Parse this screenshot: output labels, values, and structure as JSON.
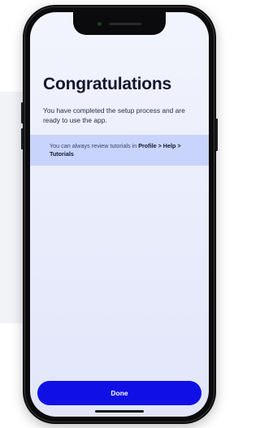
{
  "screen": {
    "title": "Congratulations",
    "message": "You have completed the setup process and are ready to use the app.",
    "tip": {
      "prefix": "You can always review tutorials in ",
      "path_part1": "Profile > Help",
      "path_sep": " ",
      "path_part2": "> Tutorials"
    },
    "done_label": "Done"
  },
  "colors": {
    "primary_button": "#1010e6",
    "tip_background": "#c8d4fb",
    "title_text": "#13152f"
  }
}
